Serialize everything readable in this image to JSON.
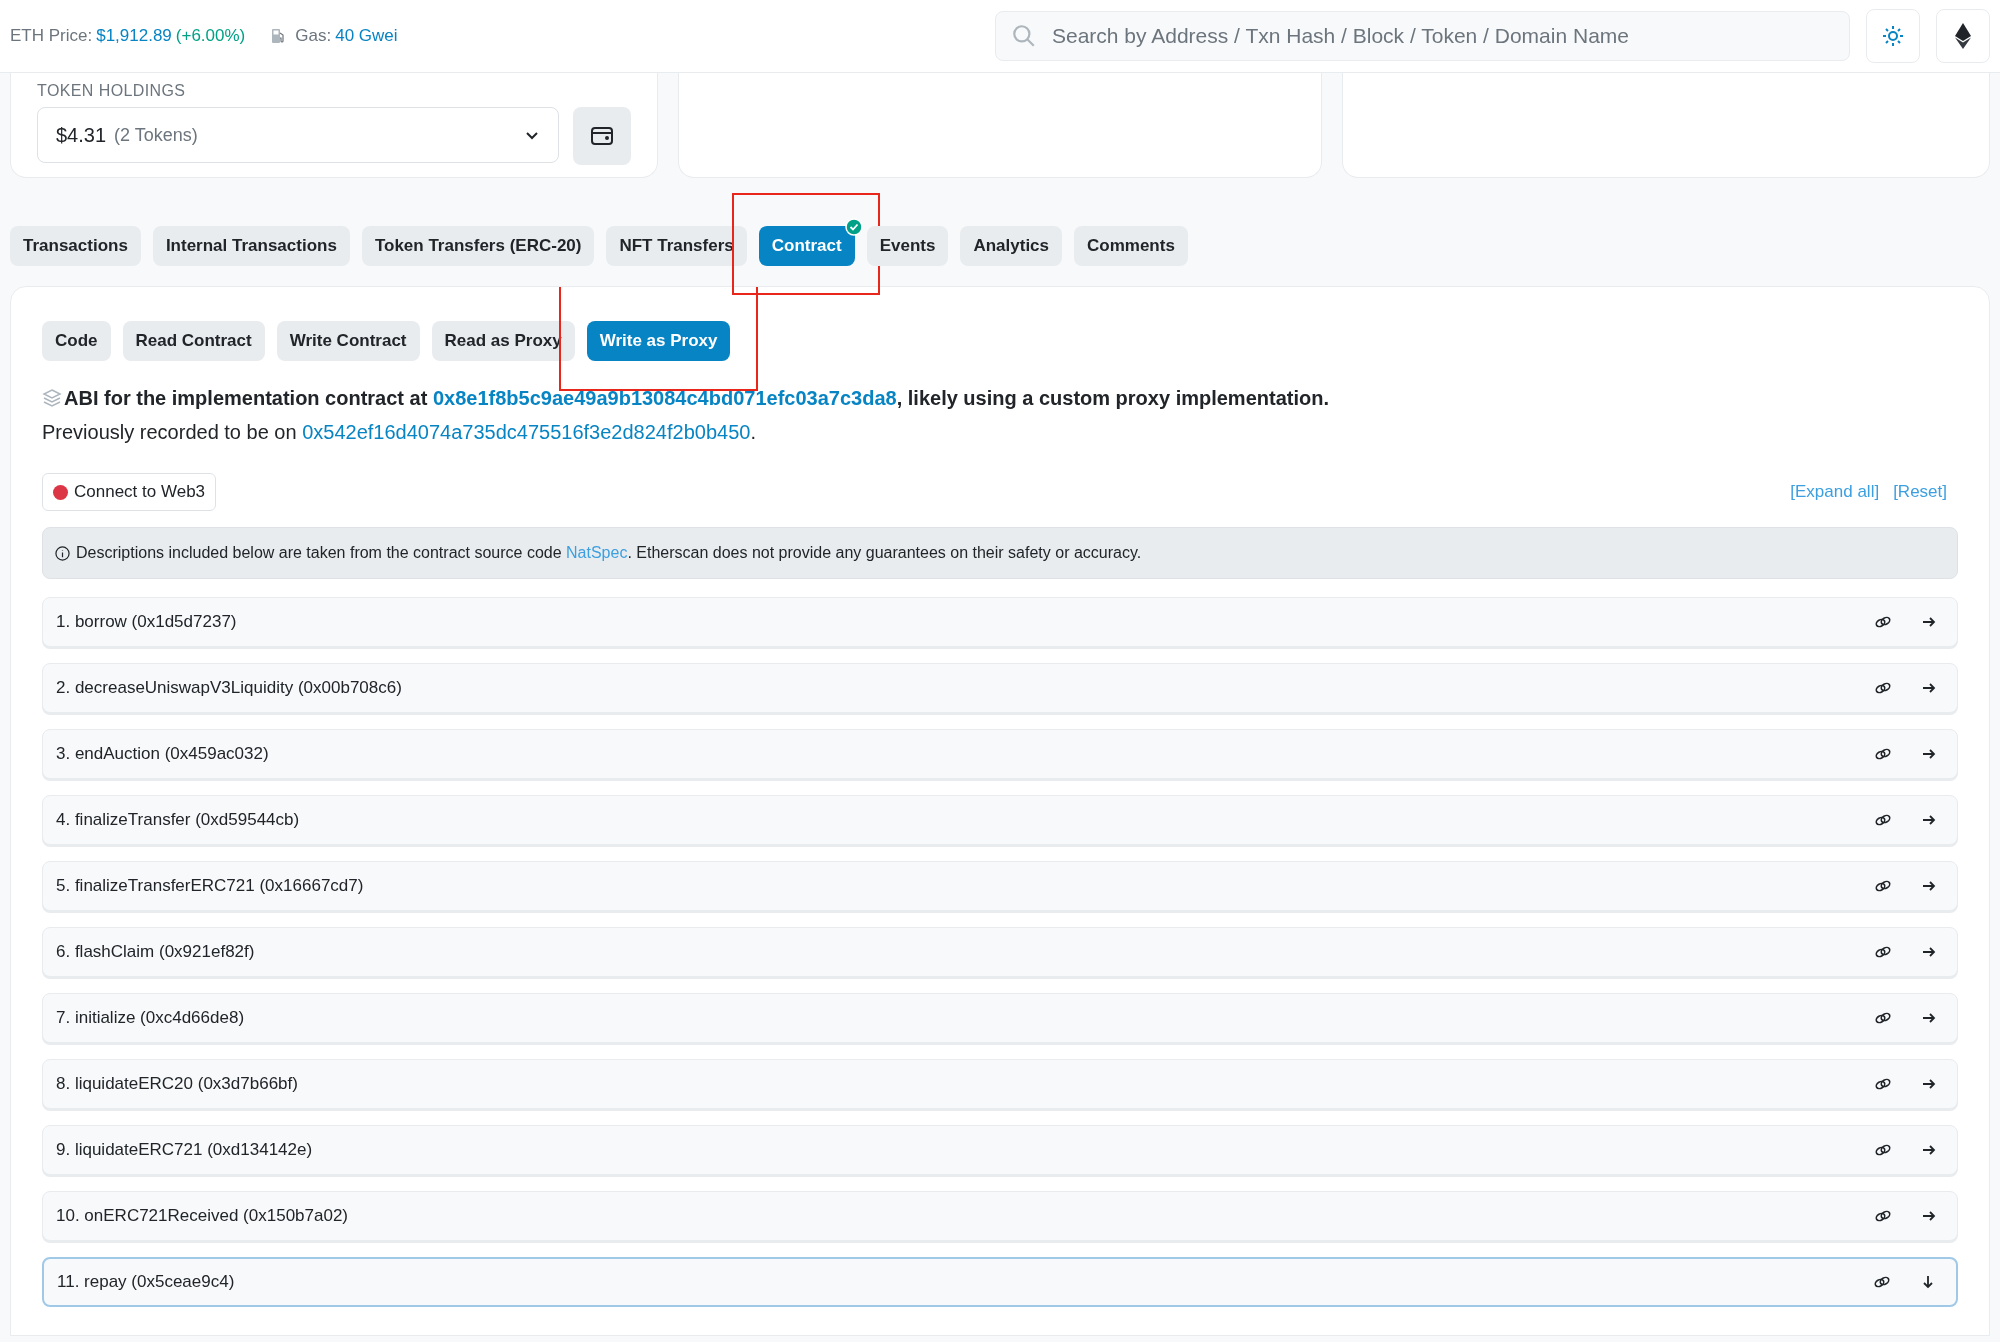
{
  "header": {
    "eth_price_label": "ETH Price:",
    "eth_price": "$1,912.89",
    "eth_change": "(+6.00%)",
    "gas_label": "Gas:",
    "gas_value": "40 Gwei",
    "search": {
      "placeholder": "Search by Address / Txn Hash / Block / Token / Domain Name"
    }
  },
  "token_holdings": {
    "label": "TOKEN HOLDINGS",
    "value": "$4.31",
    "count": "(2 Tokens)"
  },
  "tabs": [
    {
      "label": "Transactions",
      "selected": false,
      "verified": false,
      "highlighted": false
    },
    {
      "label": "Internal Transactions",
      "selected": false,
      "verified": false,
      "highlighted": false
    },
    {
      "label": "Token Transfers (ERC-20)",
      "selected": false,
      "verified": false,
      "highlighted": false
    },
    {
      "label": "NFT Transfers",
      "selected": false,
      "verified": false,
      "highlighted": false
    },
    {
      "label": "Contract",
      "selected": true,
      "verified": true,
      "highlighted": true
    },
    {
      "label": "Events",
      "selected": false,
      "verified": false,
      "highlighted": false
    },
    {
      "label": "Analytics",
      "selected": false,
      "verified": false,
      "highlighted": false
    },
    {
      "label": "Comments",
      "selected": false,
      "verified": false,
      "highlighted": false
    }
  ],
  "subtabs": [
    {
      "label": "Code",
      "selected": false,
      "highlighted": false
    },
    {
      "label": "Read Contract",
      "selected": false,
      "highlighted": false
    },
    {
      "label": "Write Contract",
      "selected": false,
      "highlighted": false
    },
    {
      "label": "Read as Proxy",
      "selected": false,
      "highlighted": false
    },
    {
      "label": "Write as Proxy",
      "selected": true,
      "highlighted": true
    }
  ],
  "abi_notice": {
    "prefix": "ABI for the implementation contract at ",
    "address": "0x8e1f8b5c9ae49a9b13084c4bd071efc03a7c3da8",
    "suffix": ", likely using a custom proxy implementation."
  },
  "previous": {
    "prefix": "Previously recorded to be on ",
    "address": "0x542ef16d4074a735dc475516f3e2d824f2b0b450",
    "suffix": "."
  },
  "connect_button": {
    "label": "Connect to Web3",
    "color": "#dc3545"
  },
  "expand_all": "[Expand all]",
  "reset": "[Reset]",
  "info": {
    "prefix": "Descriptions included below are taken from the contract source code ",
    "link": "NatSpec",
    "suffix": ". Etherscan does not provide any guarantees on their safety or accuracy."
  },
  "functions": [
    {
      "label": "1. borrow (0x1d5d7237)",
      "expanded": false
    },
    {
      "label": "2. decreaseUniswapV3Liquidity (0x00b708c6)",
      "expanded": false
    },
    {
      "label": "3. endAuction (0x459ac032)",
      "expanded": false
    },
    {
      "label": "4. finalizeTransfer (0xd59544cb)",
      "expanded": false
    },
    {
      "label": "5. finalizeTransferERC721 (0x16667cd7)",
      "expanded": false
    },
    {
      "label": "6. flashClaim (0x921ef82f)",
      "expanded": false
    },
    {
      "label": "7. initialize (0xc4d66de8)",
      "expanded": false
    },
    {
      "label": "8. liquidateERC20 (0x3d7b66bf)",
      "expanded": false
    },
    {
      "label": "9. liquidateERC721 (0xd134142e)",
      "expanded": false
    },
    {
      "label": "10. onERC721Received (0x150b7a02)",
      "expanded": false
    },
    {
      "label": "11. repay (0x5ceae9c4)",
      "expanded": true
    }
  ]
}
